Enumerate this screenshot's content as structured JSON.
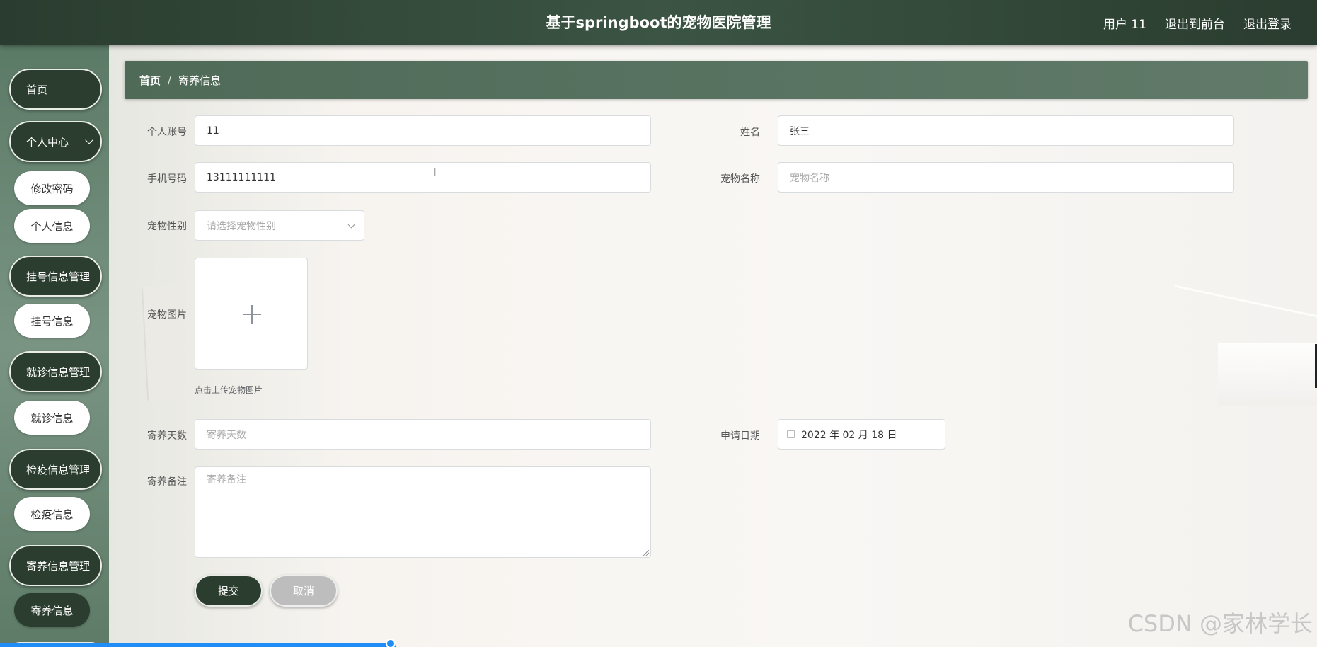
{
  "header": {
    "title": "基于springboot的宠物医院管理",
    "user": "用户 11",
    "to_front": "退出到前台",
    "logout": "退出登录"
  },
  "sidebar": {
    "home": "首页",
    "personal_center": "个人中心",
    "change_password": "修改密码",
    "personal_info": "个人信息",
    "register_mgmt": "挂号信息管理",
    "register_info": "挂号信息",
    "visit_mgmt": "就诊信息管理",
    "visit_info": "就诊信息",
    "quarantine_mgmt": "检疫信息管理",
    "quarantine_info": "检疫信息",
    "boarding_mgmt": "寄养信息管理",
    "boarding_info": "寄养信息"
  },
  "breadcrumb": {
    "home": "首页",
    "separator": "/",
    "current": "寄养信息"
  },
  "form": {
    "account_label": "个人账号",
    "account_value": "11",
    "name_label": "姓名",
    "name_value": "张三",
    "phone_label": "手机号码",
    "phone_value": "13111111111",
    "pet_name_label": "宠物名称",
    "pet_name_placeholder": "宠物名称",
    "pet_gender_label": "宠物性别",
    "pet_gender_placeholder": "请选择宠物性别",
    "pet_image_label": "宠物图片",
    "upload_tip": "点击上传宠物图片",
    "days_label": "寄养天数",
    "days_placeholder": "寄养天数",
    "apply_date_label": "申请日期",
    "apply_date_value": "2022 年 02 月 18 日",
    "remark_label": "寄养备注",
    "remark_placeholder": "寄养备注",
    "submit": "提交",
    "cancel": "取消"
  },
  "watermark": "CSDN @家林学长",
  "colors": {
    "header": "#2a3c2f",
    "accent_dark": "#2a3d2e",
    "breadcrumb": "#55705e",
    "scrollbar": "#1f8df5"
  }
}
